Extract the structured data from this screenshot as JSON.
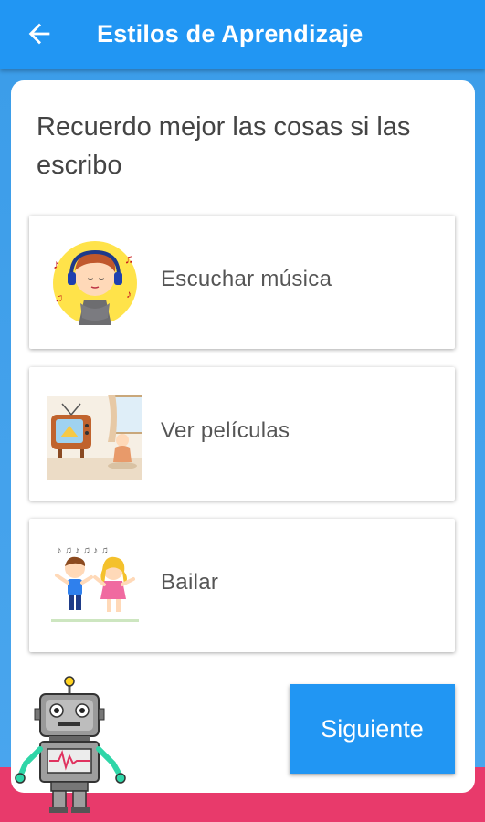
{
  "appbar": {
    "title": "Estilos de Aprendizaje",
    "back_icon": "arrow-back-icon"
  },
  "question": "Recuerdo mejor las cosas si las escribo",
  "options": [
    {
      "label": "Escuchar música",
      "icon": "boy-listening-music-illustration"
    },
    {
      "label": "Ver películas",
      "icon": "tv-room-illustration"
    },
    {
      "label": "Bailar",
      "icon": "kids-dancing-illustration"
    }
  ],
  "next_button": {
    "label": "Siguiente"
  },
  "colors": {
    "primary": "#2196f3",
    "accent_pink": "#e83a6b",
    "background": "#3a9be8"
  }
}
